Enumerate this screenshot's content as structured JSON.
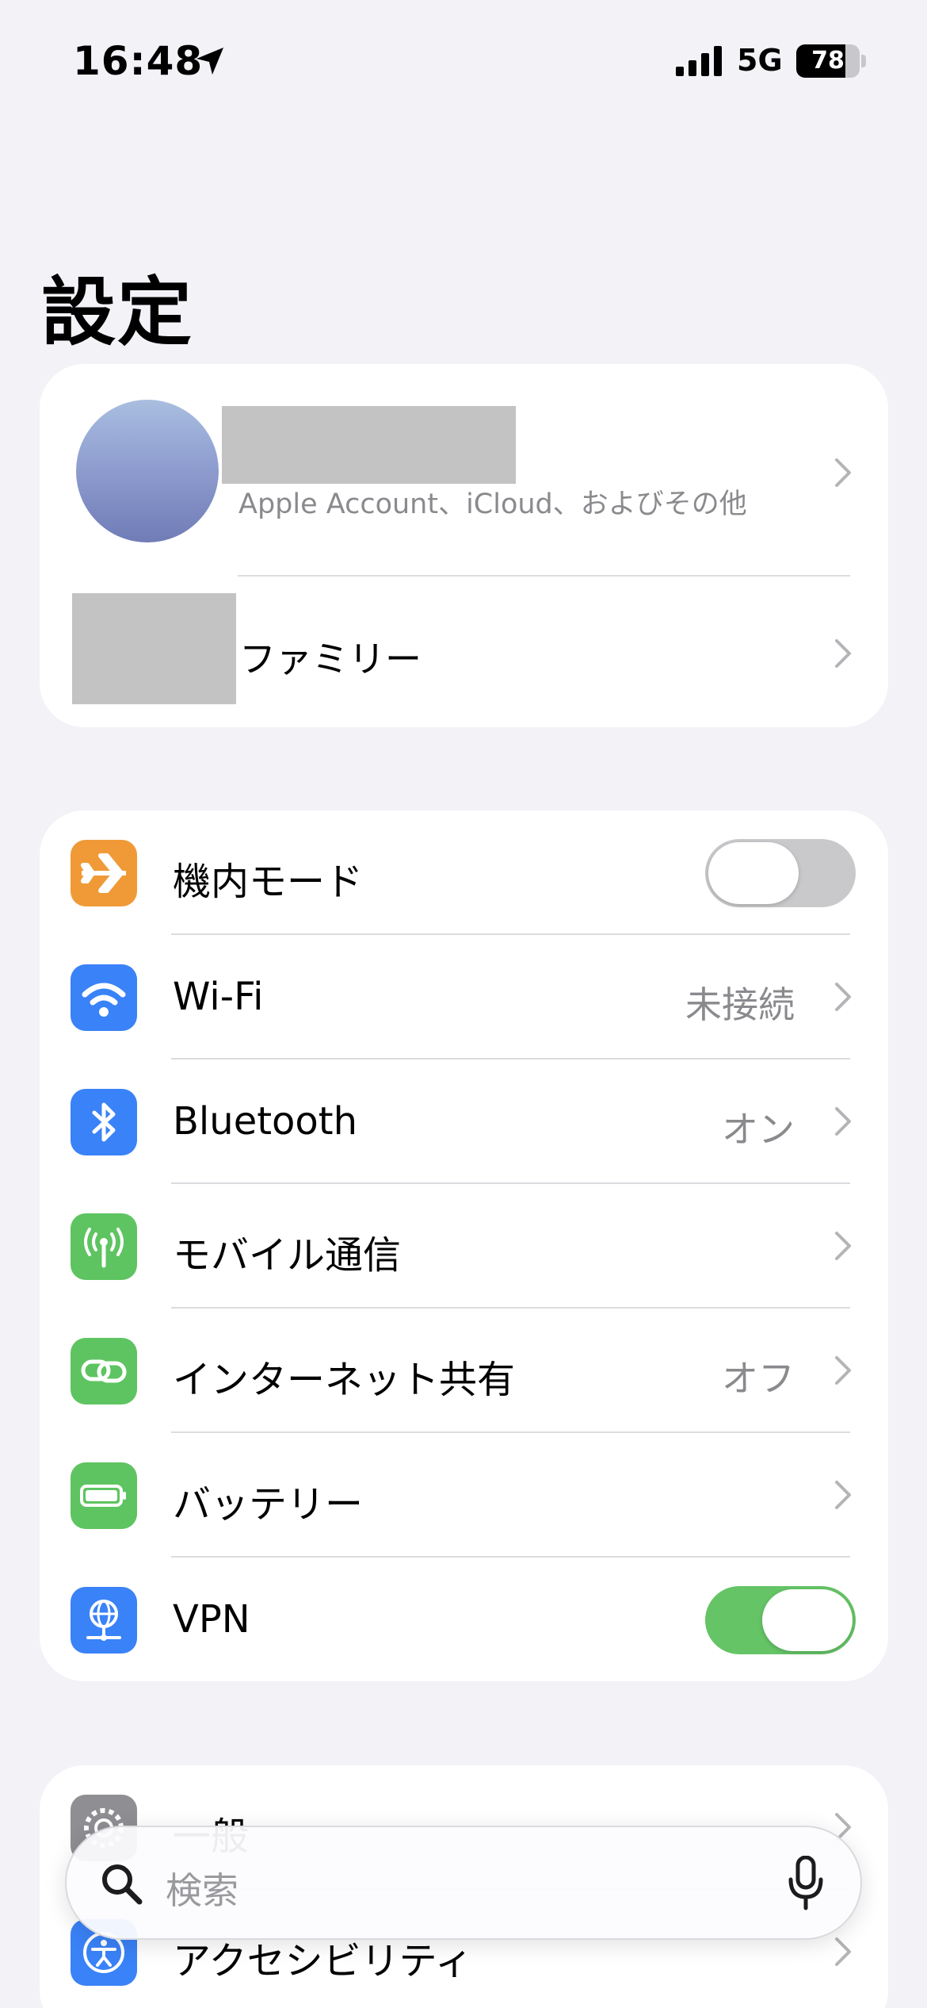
{
  "status_bar": {
    "time": "16:48",
    "network": "5G",
    "battery_percent": "78",
    "battery_level": 0.78,
    "icons": [
      "location-arrow-icon",
      "cellular-signal-icon"
    ]
  },
  "page": {
    "title": "設定"
  },
  "account": {
    "subtitle": "Apple Account、iCloud、およびその他",
    "family_label": "ファミリー"
  },
  "connectivity": {
    "airplane": {
      "label": "機内モード",
      "icon": "airplane-icon",
      "color": "#f09a37",
      "toggle_on": false
    },
    "wifi": {
      "label": "Wi-Fi",
      "value": "未接続",
      "icon": "wifi-icon",
      "color": "#3a82f7"
    },
    "bluetooth": {
      "label": "Bluetooth",
      "value": "オン",
      "icon": "bluetooth-icon",
      "color": "#3a82f7"
    },
    "cellular": {
      "label": "モバイル通信",
      "icon": "antenna-icon",
      "color": "#5ec461"
    },
    "hotspot": {
      "label": "インターネット共有",
      "value": "オフ",
      "icon": "link-icon",
      "color": "#5ec461"
    },
    "battery": {
      "label": "バッテリー",
      "icon": "battery-icon",
      "color": "#5ec461"
    },
    "vpn": {
      "label": "VPN",
      "icon": "globe-network-icon",
      "color": "#3a82f7",
      "toggle_on": true
    }
  },
  "general": {
    "general_label": "一般",
    "accessibility_label": "アクセシビリティ"
  },
  "search": {
    "placeholder": "検索",
    "icons": [
      "search-icon",
      "microphone-icon"
    ]
  }
}
